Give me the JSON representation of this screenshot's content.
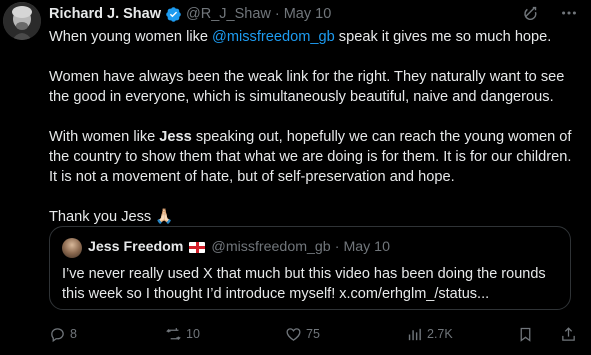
{
  "author": {
    "name": "Richard J. Shaw",
    "handle": "@R_J_Shaw",
    "separator": "·",
    "date": "May 10",
    "verified_color": "#1d9bf0"
  },
  "post": {
    "line1_pre": "When young women like ",
    "line1_mention": "@missfreedom_gb",
    "line1_post": " speak it gives me so much hope.",
    "para2": "Women have always been the weak link for the right. They naturally want to see the good in everyone, which is simultaneously beautiful, naive and dangerous.",
    "para3_pre": "With women like ",
    "para3_bold": "Jess",
    "para3_post": " speaking out, hopefully we can reach the young women of the country to show them that what we are doing is for them. It is for our children. It is not a movement of hate, but of self-preservation and hope.",
    "para4": "Thank you Jess ",
    "para4_emoji": "🙏🏻"
  },
  "quote": {
    "name": "Jess Freedom",
    "handle": "@missfreedom_gb",
    "separator": "·",
    "date": "May 10",
    "text": "I’ve never really used X that much but this video has been doing the rounds this week so I thought I’d introduce myself! x.com/erhglm_/status..."
  },
  "actions": {
    "replies": "8",
    "reposts": "10",
    "likes": "75",
    "views": "2.7K"
  },
  "colors": {
    "background": "#000000",
    "text": "#e7e9ea",
    "muted": "#71767b",
    "accent": "#1d9bf0",
    "border": "#2f3336"
  },
  "icons": {
    "top": [
      "grok-icon",
      "more-icon"
    ],
    "actions": [
      "reply-icon",
      "repost-icon",
      "like-icon",
      "views-icon",
      "bookmark-icon",
      "share-icon"
    ]
  }
}
